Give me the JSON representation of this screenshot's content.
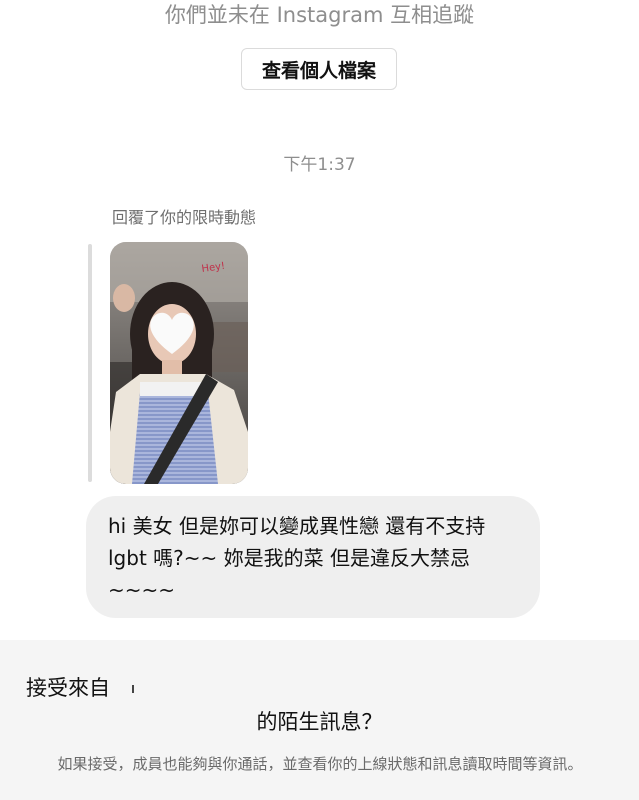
{
  "header": {
    "not_following_note": "你們並未在 Instagram 互相追蹤",
    "view_profile_label": "查看個人檔案"
  },
  "thread": {
    "timestamp": "下午1:37",
    "reply_label": "回覆了你的限時動態",
    "story_sticker_text": "Hey!",
    "message_text": "hi 美女 但是妳可以變成異性戀 還有不支持 lgbt 嗎?~~ 妳是我的菜 但是違反大禁忌 ~~~~"
  },
  "request_sheet": {
    "line1": "接受來自",
    "line2": "的陌生訊息？",
    "description": "如果接受，成員也能夠與你通話，並查看你的上線狀態和訊息讀取時間等資訊。"
  }
}
